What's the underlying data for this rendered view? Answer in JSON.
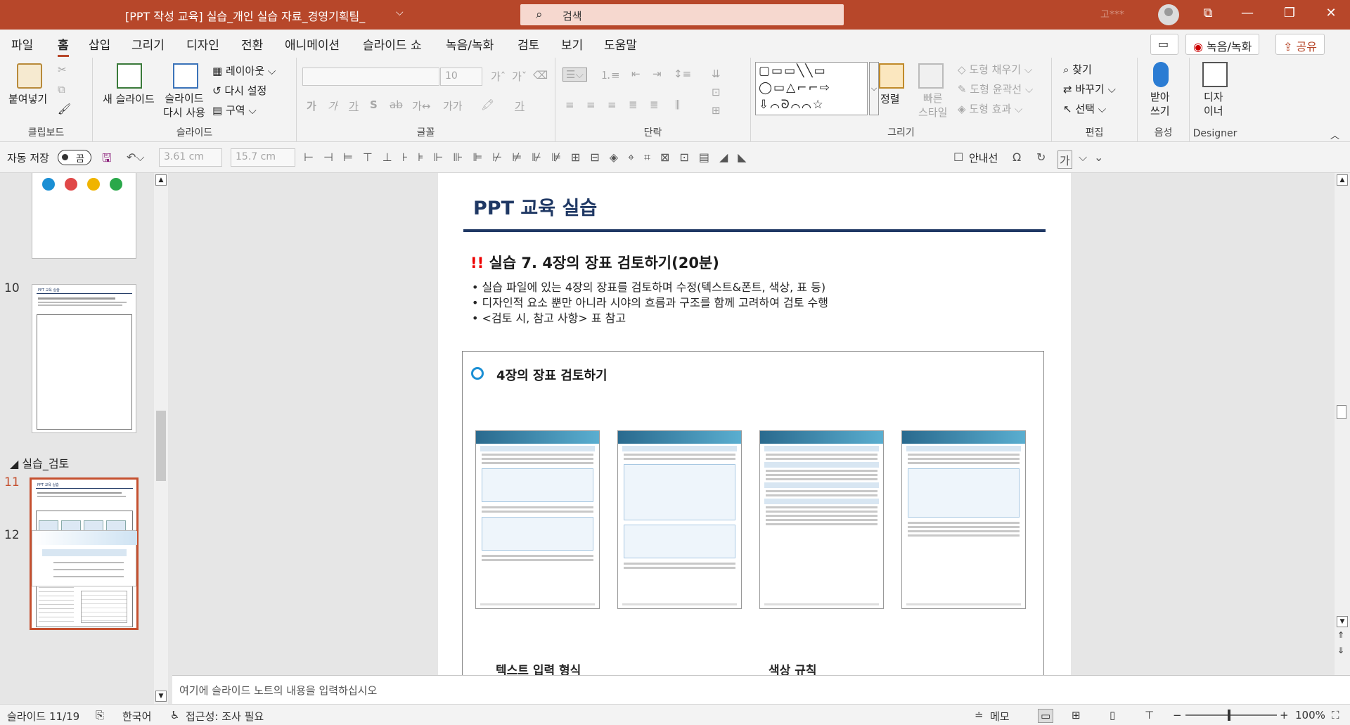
{
  "titlebar": {
    "doc_title": "[PPT 작성 교육] 실습_개인 실습 자료_경영기획팀_",
    "search_placeholder": "검색",
    "user_name": "고***",
    "window_buttons": [
      "ribbon-display-icon",
      "minimize-icon",
      "restore-icon",
      "close-icon"
    ]
  },
  "menu": {
    "tabs": [
      "파일",
      "홈",
      "삽입",
      "그리기",
      "디자인",
      "전환",
      "애니메이션",
      "슬라이드 쇼",
      "녹음/녹화",
      "검토",
      "보기",
      "도움말"
    ],
    "active_tab": "홈",
    "record_label": "녹음/녹화",
    "share_label": "공유"
  },
  "ribbon": {
    "clipboard": {
      "label": "클립보드",
      "paste": "붙여넣기"
    },
    "slides": {
      "label": "슬라이드",
      "new_slide": "새 슬라이드",
      "reuse": "슬라이드\n다시 사용",
      "layout": "레이아웃",
      "reset": "다시 설정",
      "section": "구역"
    },
    "font": {
      "label": "글꼴",
      "size": "10"
    },
    "paragraph": {
      "label": "단락"
    },
    "drawing": {
      "label": "그리기",
      "arrange": "정렬",
      "quick_styles": "빠른\n스타일",
      "fill": "도형 채우기",
      "outline": "도형 윤곽선",
      "effects": "도형 효과"
    },
    "editing": {
      "label": "편집",
      "find": "찾기",
      "replace": "바꾸기",
      "select": "선택"
    },
    "voice": {
      "label": "음성",
      "dictate": "받아\n쓰기"
    },
    "designer": {
      "label": "Designer",
      "button": "디자\n이너"
    }
  },
  "qat": {
    "autosave_label": "자동 저장",
    "autosave_state": "끔",
    "height_value": "3.61 cm",
    "width_value": "15.7 cm",
    "gridlines_label": "안내선"
  },
  "thumbnails": {
    "section_name": "실습_검토",
    "slides": [
      {
        "number": "",
        "active": false
      },
      {
        "number": "10",
        "active": false,
        "title": "PPT 교육 실습"
      },
      {
        "number": "11",
        "active": true,
        "title": "PPT 교육 실습"
      },
      {
        "number": "12",
        "active": false
      }
    ]
  },
  "slide": {
    "title": "PPT 교육 실습",
    "subtitle_mark": "!!",
    "subtitle": "실습 7. 4장의 장표 검토하기(20분)",
    "bullets": [
      "실습 파일에 있는 4장의 장표를 검토하며 수정(텍스트&폰트, 색상, 표 등)",
      "디자인적 요소 뿐만 아니라 시야의 흐름과 구조를 함께 고려하여 검토 수행",
      "<검토 시, 참고 사항> 표 참고"
    ],
    "box_title": "4장의 장표 검토하기",
    "captions": [
      "텍스트 입력 형식",
      "색상 규칙"
    ]
  },
  "notes": {
    "placeholder": "여기에 슬라이드 노트의 내용을 입력하십시오"
  },
  "status": {
    "slide_counter": "슬라이드 11/19",
    "language": "한국어",
    "accessibility": "접근성: 조사 필요",
    "notes_label": "메모",
    "zoom": "100%"
  },
  "colors": {
    "titlebar": "#b7472a",
    "accent": "#c5502f",
    "slide_title": "#1f3864",
    "ring": "#1b8fd4"
  }
}
